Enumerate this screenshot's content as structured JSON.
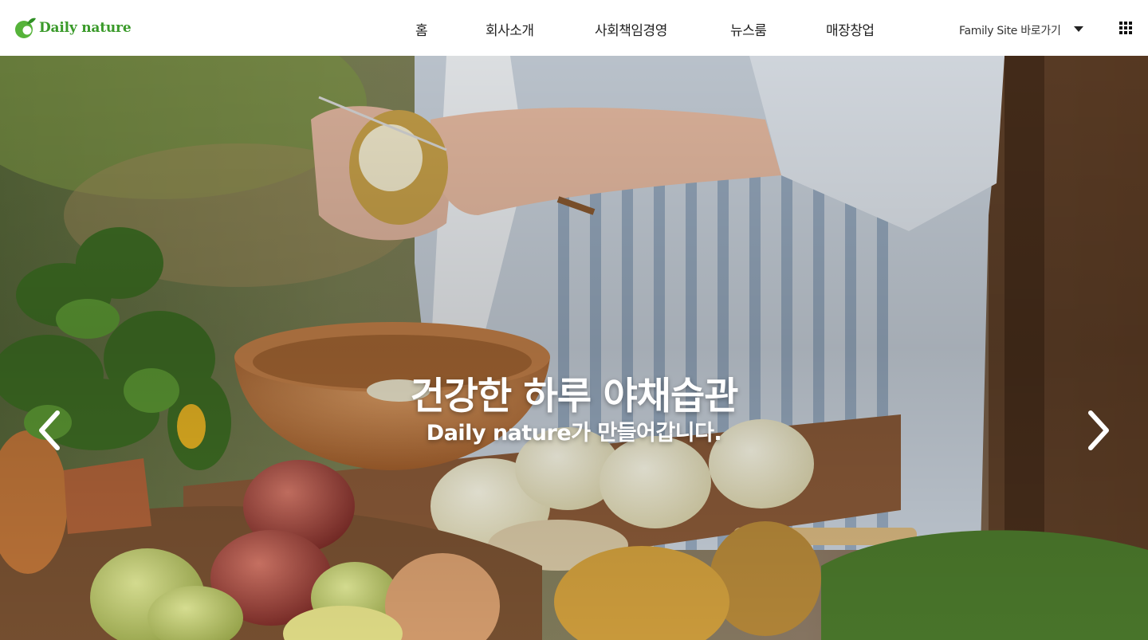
{
  "brand": {
    "name": "Daily nature",
    "color": "#3a9a2a",
    "icon": "leaf-logo-icon"
  },
  "nav": {
    "items": [
      {
        "label": "홈"
      },
      {
        "label": "회사소개"
      },
      {
        "label": "사회책임경영"
      },
      {
        "label": "뉴스룸"
      },
      {
        "label": "매장창업"
      }
    ]
  },
  "family_site": {
    "label": "Family Site 바로가기",
    "icon": "caret-down-icon"
  },
  "apps_menu": {
    "icon": "grid-menu-icon"
  },
  "hero": {
    "title": "건강한 하루 야채습관",
    "subtitle": "Daily nature가 만들어갑니다.",
    "prev_icon": "chevron-left-icon",
    "next_icon": "chevron-right-icon"
  }
}
